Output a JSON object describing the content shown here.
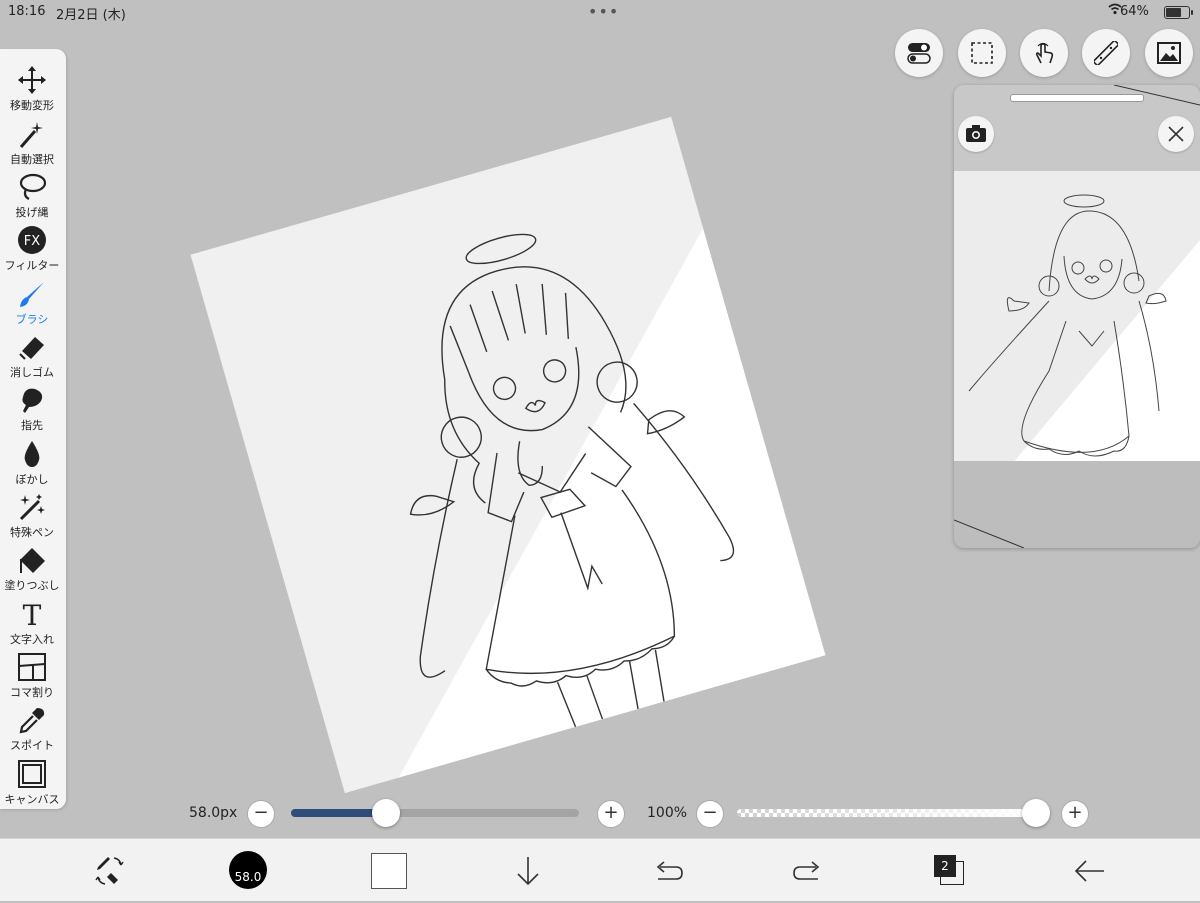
{
  "status_bar": {
    "time": "18:16",
    "date": "2月2日 (木)",
    "battery": "64%"
  },
  "tools": [
    {
      "name": "move-transform",
      "label": "移動変形",
      "icon": "move-arrows-icon"
    },
    {
      "name": "auto-select",
      "label": "自動選択",
      "icon": "magic-wand-icon"
    },
    {
      "name": "lasso",
      "label": "投げ縄",
      "icon": "lasso-icon"
    },
    {
      "name": "filter",
      "label": "フィルター",
      "icon": "fx-icon"
    },
    {
      "name": "brush",
      "label": "ブラシ",
      "icon": "brush-icon",
      "active": true
    },
    {
      "name": "eraser",
      "label": "消しゴム",
      "icon": "eraser-icon"
    },
    {
      "name": "finger",
      "label": "指先",
      "icon": "finger-smudge-icon"
    },
    {
      "name": "blur",
      "label": "ぼかし",
      "icon": "blur-drop-icon"
    },
    {
      "name": "special-pen",
      "label": "特殊ペン",
      "icon": "sparkle-pen-icon"
    },
    {
      "name": "fill",
      "label": "塗りつぶし",
      "icon": "fill-bucket-icon"
    },
    {
      "name": "text",
      "label": "文字入れ",
      "icon": "text-t-icon"
    },
    {
      "name": "panel-divide",
      "label": "コマ割り",
      "icon": "panel-grid-icon"
    },
    {
      "name": "eyedropper",
      "label": "スポイト",
      "icon": "eyedropper-icon"
    },
    {
      "name": "canvas",
      "label": "キャンバス",
      "icon": "canvas-frame-icon"
    }
  ],
  "top_buttons": [
    "toggle-icon",
    "selection-rect-icon",
    "touch-hand-icon",
    "ruler-icon",
    "image-material-icon"
  ],
  "brush_size": {
    "label": "58.0px",
    "value_fraction": 0.33,
    "minus": "−",
    "plus": "+"
  },
  "opacity": {
    "label": "100%",
    "value_fraction": 1.0,
    "minus": "−",
    "plus": "+"
  },
  "bottom_bar": {
    "brush_size_badge": "58.0",
    "layers_count": "2",
    "current_color": "#ffffff",
    "brush_color": "#000000"
  },
  "colors": {
    "accent": "#1d7bf0",
    "slider_fill": "#2e4d7a",
    "background": "#c0c0c0"
  }
}
